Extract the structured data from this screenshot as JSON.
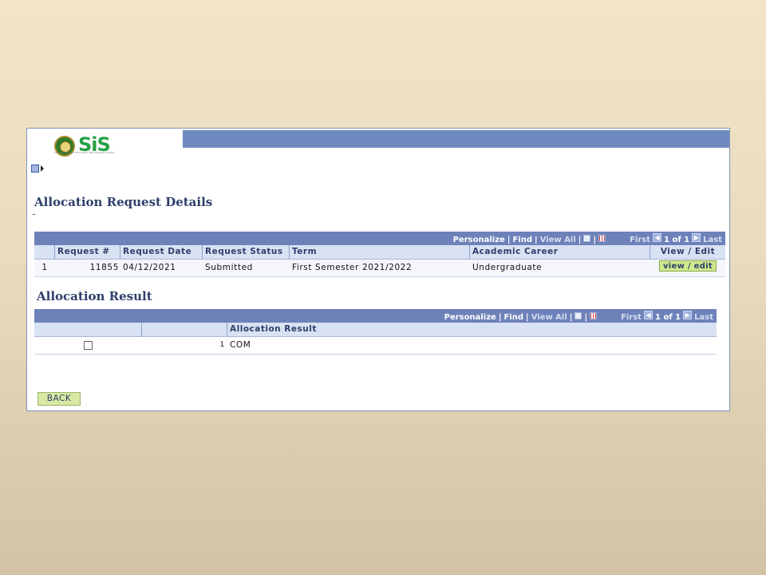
{
  "app": {
    "logo_text": "SiS",
    "logo_subtitle": "SSU-SIS Student Information Management System"
  },
  "section1": {
    "title": "Allocation Request Details",
    "nav": {
      "personalize": "Personalize",
      "find": "Find",
      "view_all": "View All",
      "first": "First",
      "page": "1 of 1",
      "last": "Last"
    },
    "columns": [
      "Request #",
      "Request Date",
      "Request Status",
      "Term",
      "Academic Career",
      "View / Edit"
    ],
    "rows": [
      {
        "index": "1",
        "request_no": "11855",
        "request_date": "04/12/2021",
        "status": "Submitted",
        "term": "First Semester 2021/2022",
        "career": "Undergraduate",
        "action": "view / edit"
      }
    ]
  },
  "section2": {
    "title": "Allocation Result",
    "nav": {
      "personalize": "Personalize",
      "find": "Find",
      "view_all": "View All",
      "first": "First",
      "page": "1 of 1",
      "last": "Last"
    },
    "columns": [
      "",
      "",
      "Allocation Result"
    ],
    "rows": [
      {
        "index": "1",
        "result": "COM"
      }
    ]
  },
  "footer": {
    "back_label": "BACK"
  },
  "colors": {
    "header_blue": "#6e82ba",
    "title_navy": "#2e3f6a",
    "button_green": "#cfe88e"
  }
}
